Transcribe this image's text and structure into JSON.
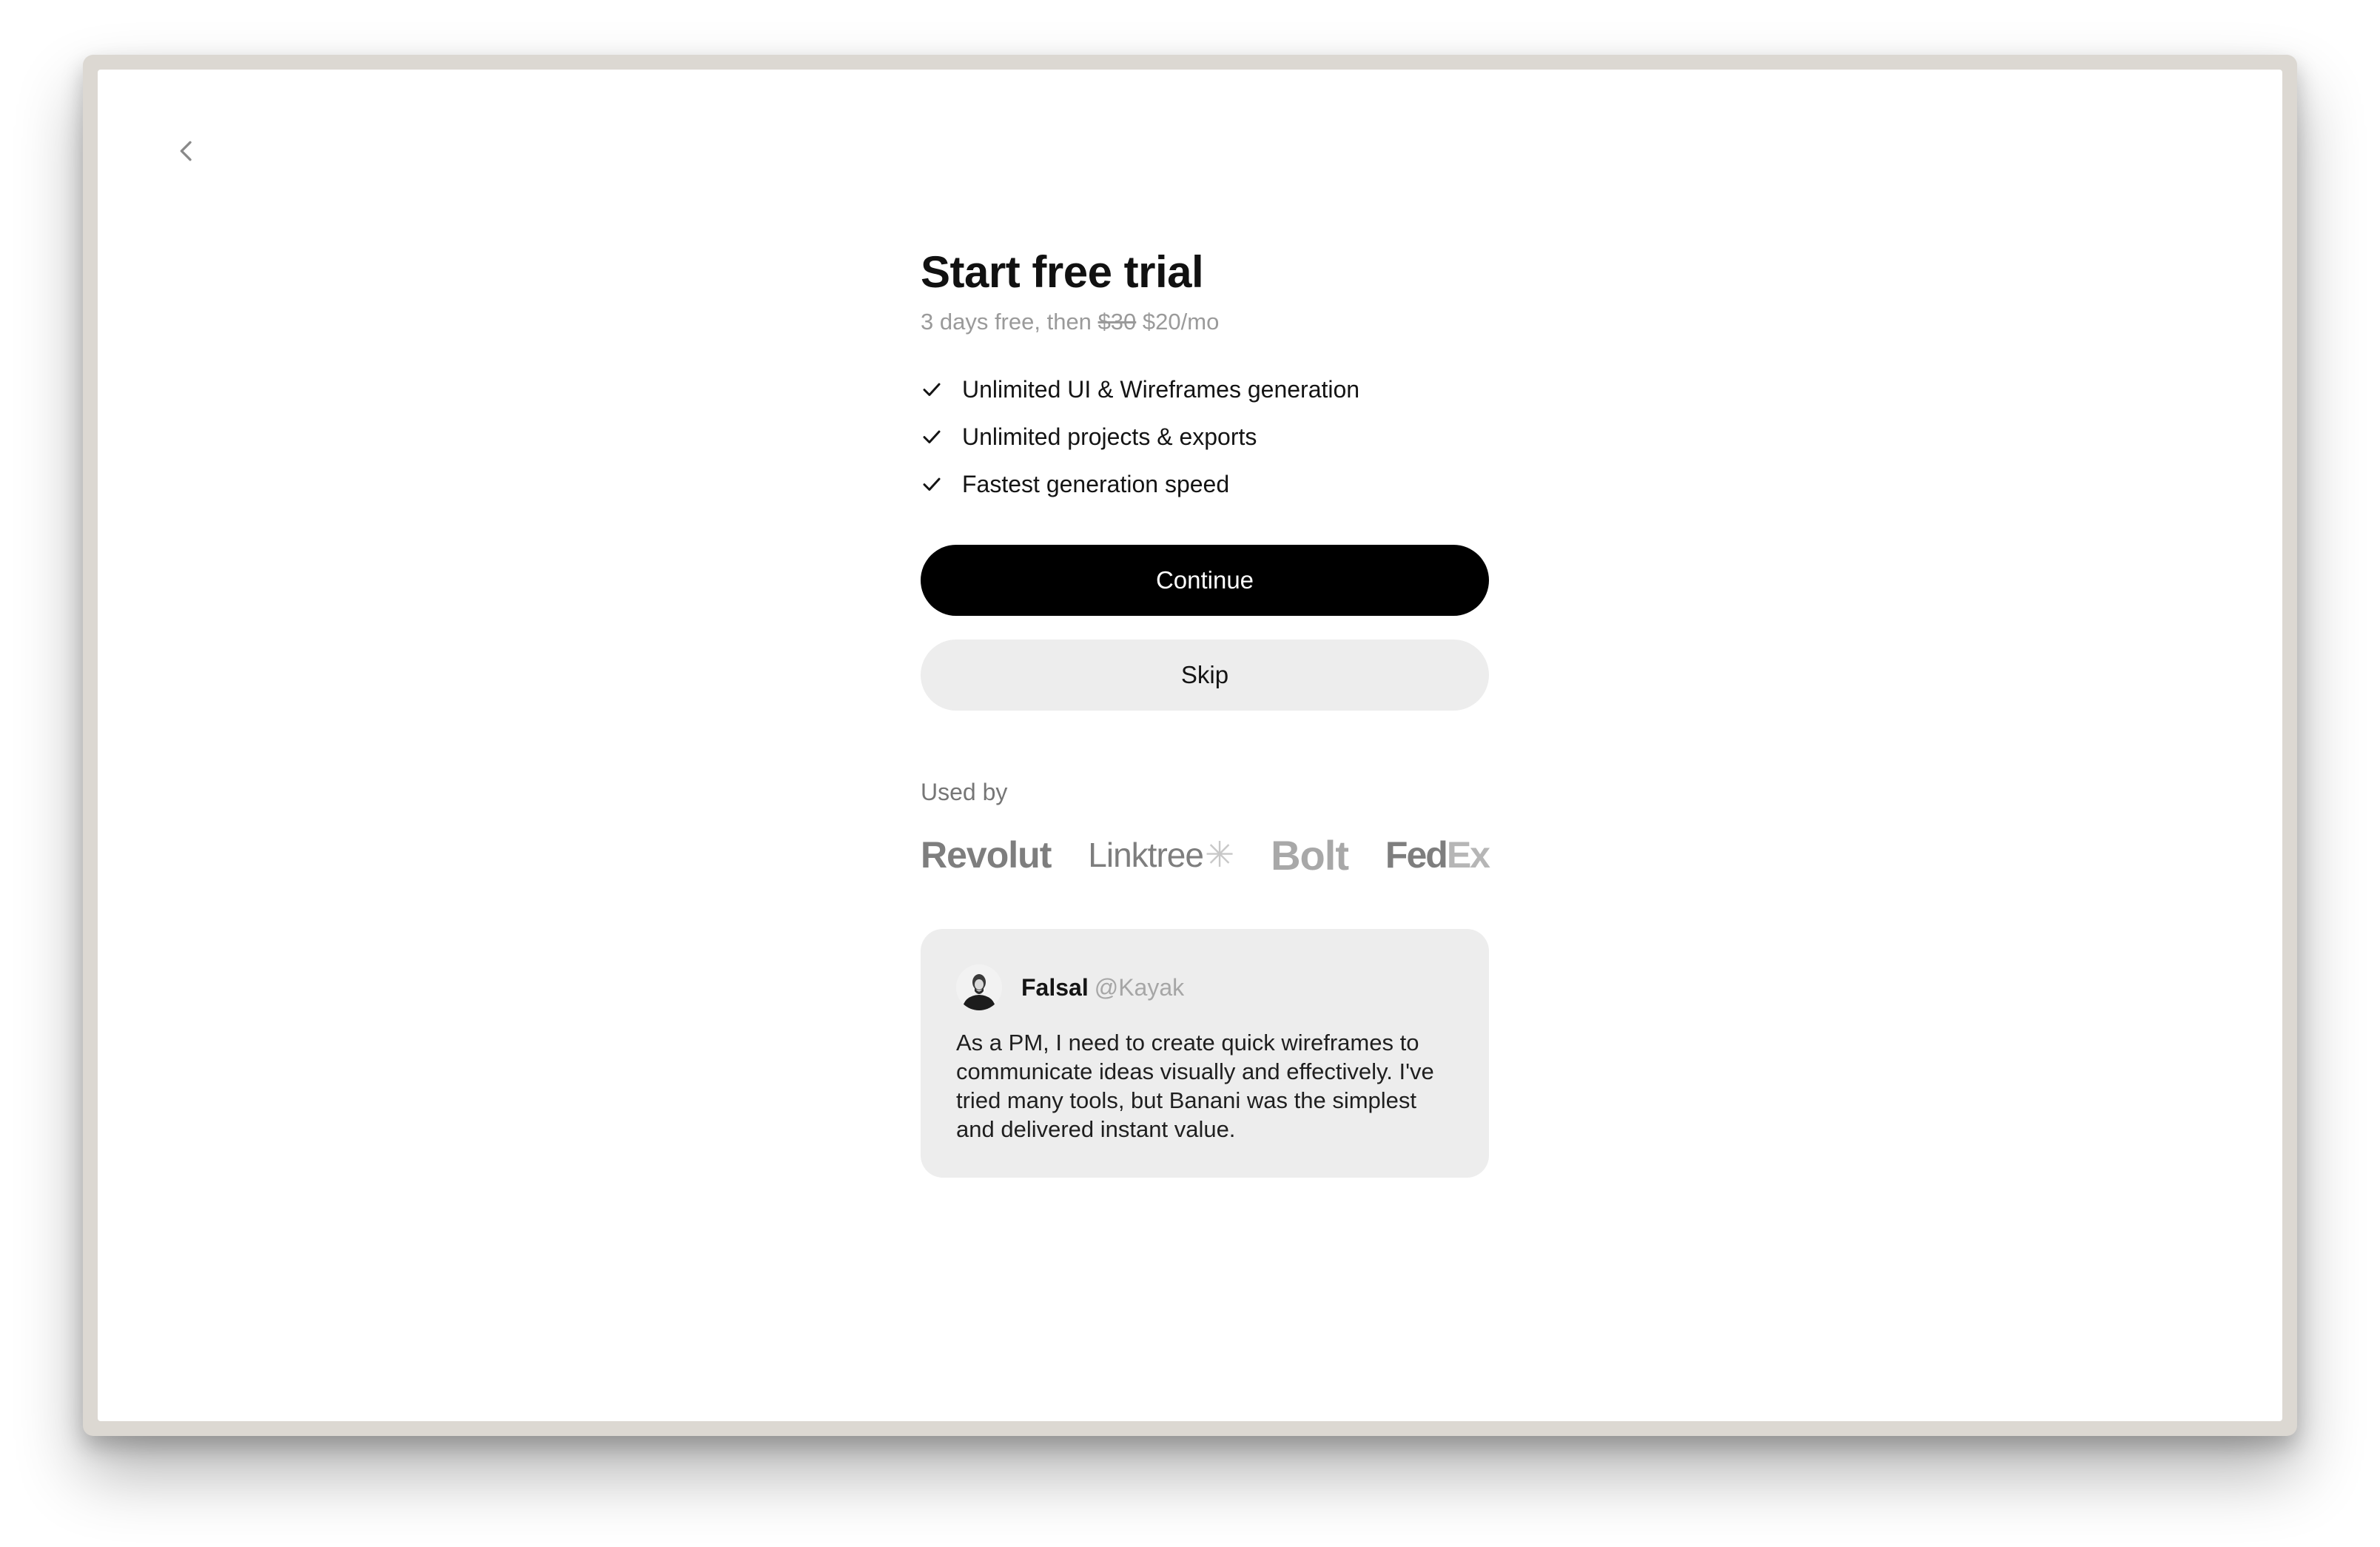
{
  "header": {
    "back_icon": "chevron-left-icon"
  },
  "trial": {
    "title": "Start free trial",
    "subtitle_prefix": "3 days free, then",
    "old_price": "$30",
    "new_price": "$20/mo"
  },
  "features": [
    {
      "icon": "check-icon",
      "label": "Unlimited UI & Wireframes generation"
    },
    {
      "icon": "check-icon",
      "label": "Unlimited projects & exports"
    },
    {
      "icon": "check-icon",
      "label": "Fastest generation speed"
    }
  ],
  "actions": {
    "continue_label": "Continue",
    "skip_label": "Skip"
  },
  "social_proof": {
    "label": "Used by",
    "logos": [
      "Revolut",
      "Linktree",
      "Bolt",
      "FedEx"
    ],
    "linktree_text": "Linktree",
    "linktree_mark": "✳",
    "bolt_text": "Bolt",
    "fedex_fed": "Fed",
    "fedex_ex": "Ex"
  },
  "testimonial": {
    "name": "Falsal",
    "handle": "@Kayak",
    "quote": "As a PM, I need to create quick wireframes to communicate ideas visually and effectively. I've tried many tools, but Banani was the simplest and delivered instant value."
  },
  "colors": {
    "primary_button": "#000000",
    "secondary_button": "#ededed",
    "card_background": "#ededed",
    "muted_text": "#9a9a9a"
  }
}
